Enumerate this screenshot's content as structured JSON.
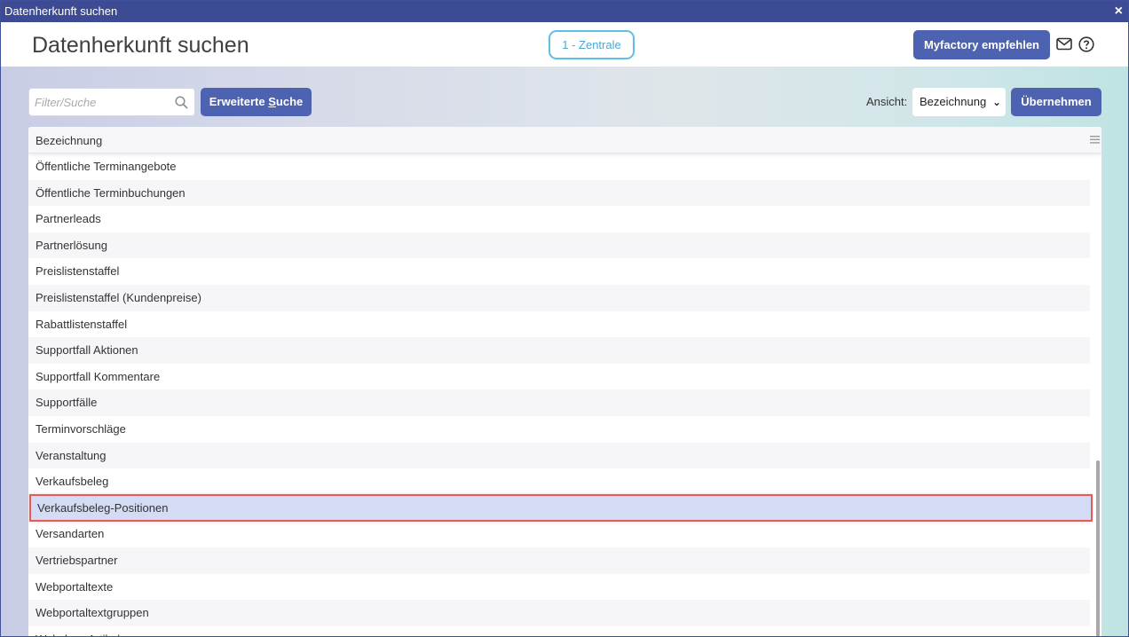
{
  "window": {
    "title": "Datenherkunft suchen",
    "close_glyph": "×"
  },
  "header": {
    "title": "Datenherkunft suchen",
    "tenant": "1 - Zentrale",
    "recommend_label": "Myfactory empfehlen",
    "icons": [
      "mail-icon",
      "help-icon"
    ]
  },
  "toolbar": {
    "search_placeholder": "Filter/Suche",
    "advanced_search_prefix": "Erweiterte ",
    "advanced_search_underlined": "S",
    "advanced_search_suffix": "uche",
    "view_label": "Ansicht:",
    "view_value": "Bezeichnung",
    "apply_label": "Übernehmen"
  },
  "grid": {
    "column_header": "Bezeichnung",
    "rows": [
      "Öffentliche Terminangebote",
      "Öffentliche Terminbuchungen",
      "Partnerleads",
      "Partnerlösung",
      "Preislistenstaffel",
      "Preislistenstaffel (Kundenpreise)",
      "Rabattlistenstaffel",
      "Supportfall Aktionen",
      "Supportfall Kommentare",
      "Supportfälle",
      "Terminvorschläge",
      "Veranstaltung",
      "Verkaufsbeleg",
      "Verkaufsbeleg-Positionen",
      "Versandarten",
      "Vertriebspartner",
      "Webportaltexte",
      "Webportaltextgruppen",
      "Webshop-Artikel"
    ],
    "selected": "Verkaufsbeleg-Positionen"
  },
  "colors": {
    "titlebar": "#3d4b94",
    "button": "#4d62b0",
    "tenant_border": "#5dc1e6",
    "selected_row": "#d4dcf5",
    "highlight_border": "#e35b5b"
  }
}
